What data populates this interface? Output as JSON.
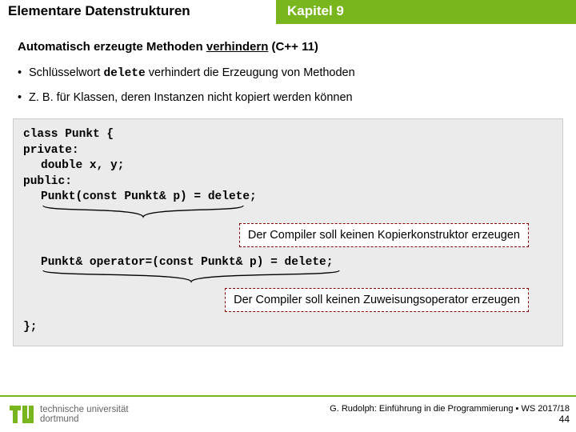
{
  "header": {
    "title_left": "Elementare Datenstrukturen",
    "title_right": "Kapitel 9"
  },
  "section": {
    "title_a": "Automatisch erzeugte Methoden ",
    "title_b": "verhindern",
    "title_c": " (C++ 11)"
  },
  "bullets": {
    "b1a": "Schlüsselwort ",
    "b1kw": "delete",
    "b1b": " verhindert die Erzeugung von Methoden",
    "b2": "Z. B. für Klassen, deren Instanzen nicht kopiert werden können"
  },
  "code": {
    "l1": "class Punkt {",
    "l2": "private:",
    "l3": "double x, y;",
    "l4": "public:",
    "l5": "Punkt(const Punkt& p) = delete;",
    "l6": "Punkt& operator=(const Punkt& p) = delete;",
    "l7": "};"
  },
  "notes": {
    "n1": "Der Compiler soll keinen Kopierkonstruktor erzeugen",
    "n2": "Der Compiler soll keinen Zuweisungsoperator erzeugen"
  },
  "footer": {
    "logo_l1": "technische universität",
    "logo_l2": "dortmund",
    "credit": "G. Rudolph: Einführung in die Programmierung ▪ WS 2017/18",
    "page": "44"
  },
  "colors": {
    "accent": "#79b51c",
    "dash": "#800000"
  }
}
